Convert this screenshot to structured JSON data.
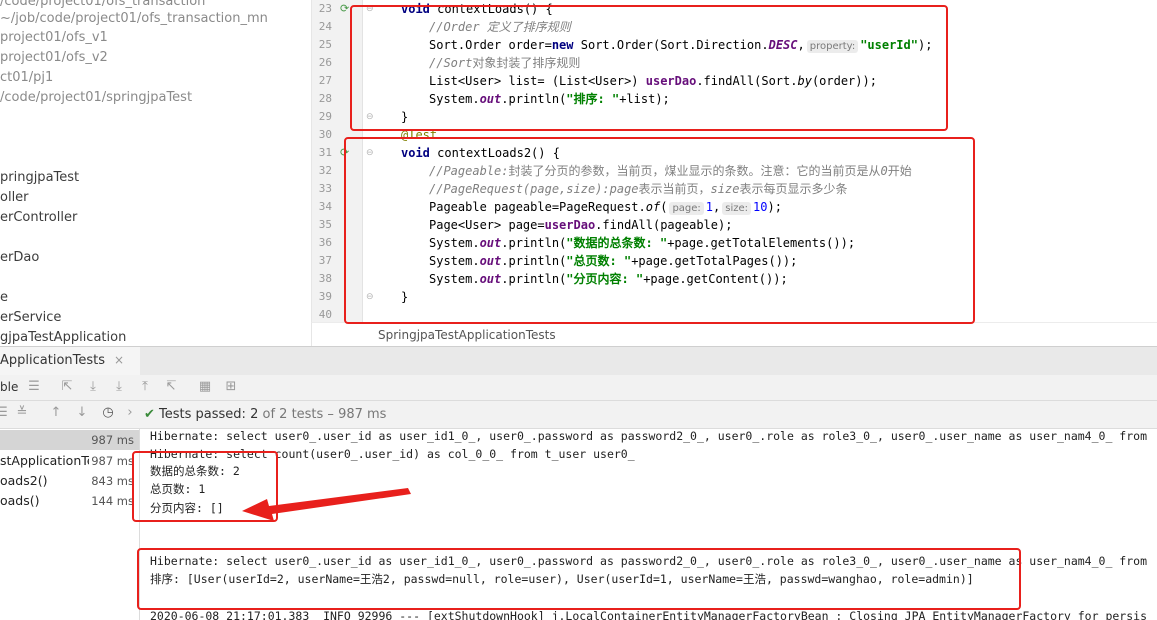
{
  "project_tree": {
    "items": [
      {
        "label": "/code/project01/ofs_transaction",
        "gray": true
      },
      {
        "label": "~/job/code/project01/ofs_transaction_mn",
        "gray": true
      },
      {
        "label": "project01/ofs_v1",
        "gray": true
      },
      {
        "label": "project01/ofs_v2",
        "gray": true
      },
      {
        "label": "ct01/pj1",
        "gray": true
      },
      {
        "label": "/code/project01/springjpaTest",
        "gray": true
      },
      {
        "label": "",
        "gray": false
      },
      {
        "label": "",
        "gray": false
      },
      {
        "label": "pringjpaTest",
        "gray": false
      },
      {
        "label": "oller",
        "gray": false
      },
      {
        "label": "erController",
        "gray": false
      },
      {
        "label": "",
        "gray": false
      },
      {
        "label": "erDao",
        "gray": false
      },
      {
        "label": "",
        "gray": false
      },
      {
        "label": "e",
        "gray": false
      },
      {
        "label": "erService",
        "gray": false
      },
      {
        "label": "gjpaTestApplication",
        "gray": false
      }
    ]
  },
  "editor": {
    "line_numbers": [
      "23",
      "24",
      "25",
      "26",
      "27",
      "28",
      "29",
      "30",
      "31",
      "32",
      "33",
      "34",
      "35",
      "36",
      "37",
      "38",
      "39",
      "40"
    ],
    "code": {
      "l23_kw": "void",
      "l23_rest": " contextLoads() {",
      "l24": "//Order 定义了排序规则",
      "l25_a": "Sort.Order order=",
      "l25_new": "new",
      "l25_b": " Sort.Order(Sort.Direction.",
      "l25_desc": "DESC",
      "l25_c": ",",
      "l25_hint": "property:",
      "l25_str": "\"userId\"",
      "l25_d": ");",
      "l26_a": "//Sort",
      "l26_b": "对象封装了排序规则",
      "l27_a": "List<User> list= (List<User>) ",
      "l27_var": "userDao",
      "l27_b": ".findAll(Sort.",
      "l27_by": "by",
      "l27_c": "(order));",
      "l28_a": "System.",
      "l28_out": "out",
      "l28_b": ".println(",
      "l28_str": "\"排序: \"",
      "l28_c": "+list);",
      "l29": "}",
      "l30": "@Test",
      "l31_kw": "void",
      "l31_rest": " contextLoads2() {",
      "l32_a": "//Pageable:",
      "l32_b": "封装了分页的参数，当前页，煤业显示的条数。注意：它的当前页是从",
      "l32_c": "0",
      "l32_d": "开始",
      "l33_a": "//PageRequest(page,size):page",
      "l33_b": "表示当前页，",
      "l33_c": "size",
      "l33_d": "表示每页显示多少条",
      "l34_a": "Pageable pageable=PageRequest.",
      "l34_of": "of",
      "l34_b": "(",
      "l34_hint1": "page:",
      "l34_n1": "1",
      "l34_c": ",",
      "l34_hint2": "size:",
      "l34_n2": "10",
      "l34_d": ");",
      "l35_a": "Page<User> page=",
      "l35_var": "userDao",
      "l35_b": ".findAll(pageable);",
      "l36_a": "System.",
      "l36_out": "out",
      "l36_b": ".println(",
      "l36_str": "\"数据的总条数: \"",
      "l36_c": "+page.getTotalElements());",
      "l37_a": "System.",
      "l37_out": "out",
      "l37_b": ".println(",
      "l37_str": "\"总页数: \"",
      "l37_c": "+page.getTotalPages());",
      "l38_a": "System.",
      "l38_out": "out",
      "l38_b": ".println(",
      "l38_str": "\"分页内容: \"",
      "l38_c": "+page.getContent());",
      "l39": "}"
    },
    "breadcrumb": "SpringjpaTestApplicationTests"
  },
  "run_panel": {
    "tab_label": "ApplicationTests",
    "tab_close": "×",
    "left_cut_label": "ble",
    "status_passed": "Tests passed:",
    "status_count": "2",
    "status_rest": "of 2 tests – 987 ms",
    "tests": [
      {
        "name": "",
        "duration": "987 ms",
        "selected": true
      },
      {
        "name": "stApplicationTe",
        "duration": "987 ms",
        "selected": false
      },
      {
        "name": "oads2()",
        "duration": "843 ms",
        "selected": false
      },
      {
        "name": "oads()",
        "duration": "144 ms",
        "selected": false
      }
    ],
    "console": {
      "line1": "Hibernate: select user0_.user_id as user_id1_0_, user0_.password as password2_0_, user0_.role as role3_0_, user0_.user_name as user_nam4_0_ from",
      "line2": "Hibernate: select count(user0_.user_id) as col_0_0_ from t_user user0_",
      "line3": "数据的总条数: 2",
      "line4": "总页数: 1",
      "line5": "分页内容: []",
      "line6": "Hibernate: select user0_.user_id as user_id1_0_, user0_.password as password2_0_, user0_.role as role3_0_, user0_.user_name as user_nam4_0_ from",
      "line7": "排序: [User(userId=2, userName=王浩2, passwd=null, role=user), User(userId=1, userName=王浩, passwd=wanghao, role=admin)]",
      "line8": "2020-06-08 21:17:01.383  INFO 92996 --- [extShutdownHook] j.LocalContainerEntityManagerFactoryBean : Closing JPA EntityManagerFactory for persis"
    }
  },
  "colors": {
    "annotation_red": "#e8201c",
    "test_pass_green": "#3a8a3a"
  }
}
